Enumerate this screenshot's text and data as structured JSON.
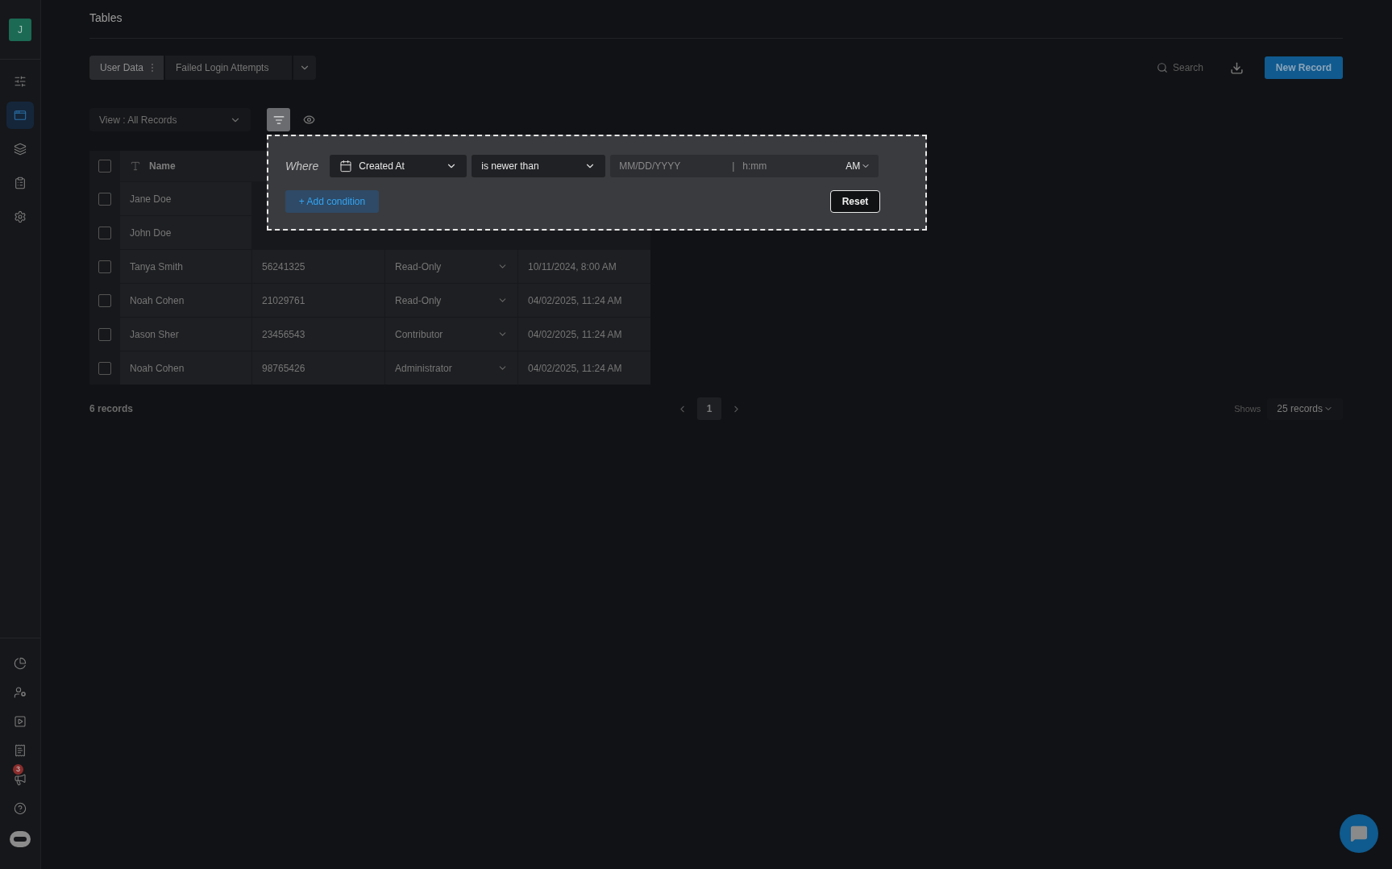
{
  "sidebar": {
    "avatar": "J",
    "top_items": [
      {
        "kind": "sliders",
        "selected": false
      },
      {
        "kind": "window",
        "selected": true
      },
      {
        "kind": "layers",
        "selected": false
      },
      {
        "kind": "clipboard",
        "selected": false
      },
      {
        "kind": "gear",
        "selected": false
      }
    ],
    "bottom_items": [
      {
        "kind": "pie",
        "selected": false
      },
      {
        "kind": "user-gear",
        "selected": false
      },
      {
        "kind": "play",
        "selected": false
      },
      {
        "kind": "receipt",
        "selected": false
      },
      {
        "kind": "megaphone",
        "selected": false,
        "badge": "3"
      },
      {
        "kind": "help",
        "selected": false
      },
      {
        "kind": "bot",
        "selected": false
      }
    ]
  },
  "page_title": "Tables",
  "table_tabs": [
    {
      "label": "User Data",
      "selected": true
    },
    {
      "label": "Failed Login Attempts",
      "selected": false
    }
  ],
  "search": {
    "placeholder": "Search"
  },
  "new_record_button": "New Record",
  "view_select": "View : All Records",
  "filter_button": {
    "expanded": true
  },
  "filter_popover": {
    "where": "Where",
    "field": "Created At",
    "operator": "is newer than",
    "date": {
      "placeholder": "MM/DD/YYYY"
    },
    "separator": "|",
    "time": {
      "placeholder": "h:mm"
    },
    "meridiem": "AM",
    "add_condition": "+ Add condition",
    "reset": "Reset"
  },
  "table": {
    "select_all_checked": false,
    "columns": [
      {
        "label": "Name"
      }
    ],
    "rows": [
      {
        "checked": false,
        "name": "Jane Doe"
      },
      {
        "checked": false,
        "name": "John Doe"
      },
      {
        "checked": false,
        "name": "Tanya Smith",
        "column_2": "56241325",
        "column_3": "Read-Only",
        "column_4": "10/11/2024, 8:00 AM"
      },
      {
        "checked": false,
        "name": "Noah Cohen",
        "column_2": "21029761",
        "column_3": "Read-Only",
        "column_4": "04/02/2025, 11:24 AM"
      },
      {
        "checked": false,
        "name": "Jason Sher",
        "column_2": "23456543",
        "column_3": "Contributor",
        "column_4": "04/02/2025, 11:24 AM"
      },
      {
        "checked": false,
        "name": "Noah Cohen",
        "column_2": "98765426",
        "column_3": "Administrator",
        "column_4": "04/02/2025, 11:24 AM"
      }
    ]
  },
  "footer": {
    "count": "6 records",
    "pages": [
      {
        "label": "1",
        "selected": true
      }
    ],
    "shows_label": "Shows",
    "page_size": "25 records"
  }
}
